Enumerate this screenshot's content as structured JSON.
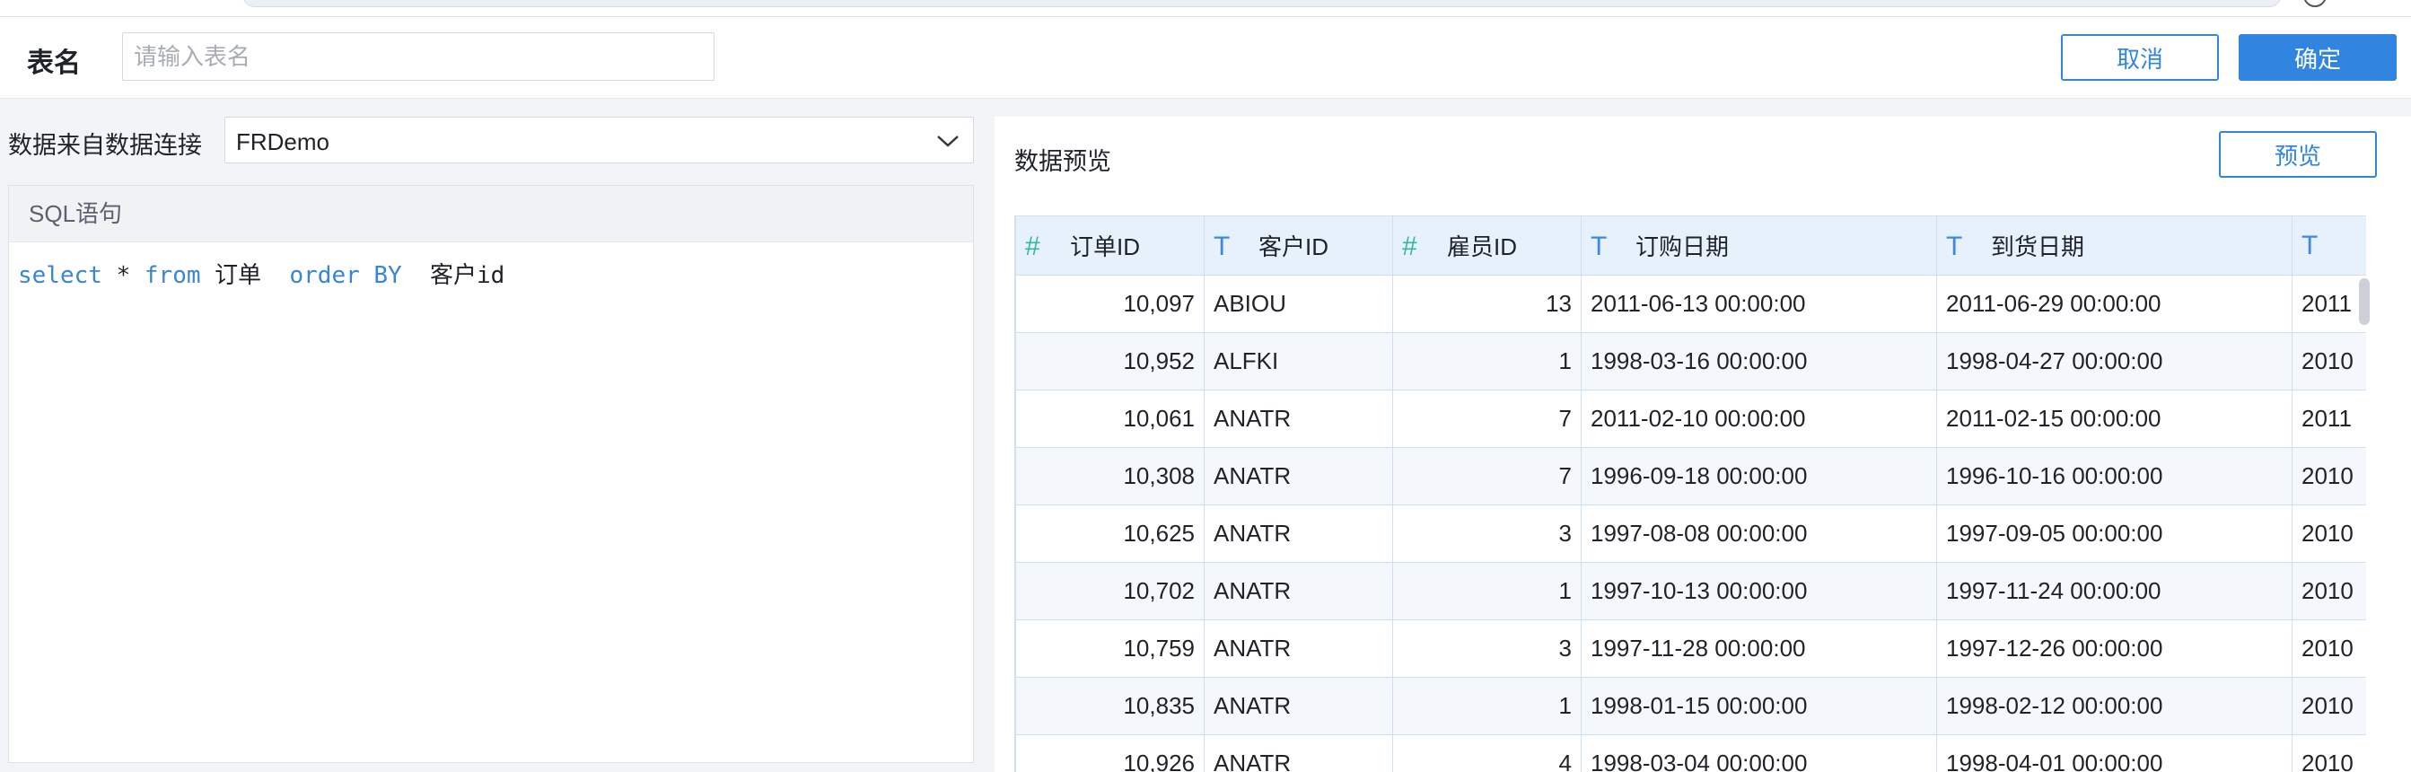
{
  "header": {
    "table_name_label": "表名",
    "table_name_placeholder": "请输入表名",
    "table_name_value": "",
    "cancel_label": "取消",
    "confirm_label": "确定"
  },
  "left": {
    "source_label": "数据来自数据连接",
    "source_value": "FRDemo",
    "sql_title": "SQL语句",
    "sql_tokens": {
      "select": "select",
      "star": " * ",
      "from": "from",
      "table": " 订单  ",
      "order_by": "order BY",
      "column": "  客户id"
    }
  },
  "preview": {
    "title": "数据预览",
    "button_label": "预览",
    "columns": [
      {
        "type": "number",
        "icon": "#",
        "label": "订单ID"
      },
      {
        "type": "text",
        "icon": "T",
        "label": "客户ID"
      },
      {
        "type": "number",
        "icon": "#",
        "label": "雇员ID"
      },
      {
        "type": "text",
        "icon": "T",
        "label": "订购日期"
      },
      {
        "type": "text",
        "icon": "T",
        "label": "到货日期"
      },
      {
        "type": "text",
        "icon": "T",
        "label": ""
      }
    ],
    "rows": [
      [
        "10,097",
        "ABIOU",
        "13",
        "2011-06-13 00:00:00",
        "2011-06-29 00:00:00",
        "2011"
      ],
      [
        "10,952",
        "ALFKI",
        "1",
        "1998-03-16 00:00:00",
        "1998-04-27 00:00:00",
        "2010"
      ],
      [
        "10,061",
        "ANATR",
        "7",
        "2011-02-10 00:00:00",
        "2011-02-15 00:00:00",
        "2011"
      ],
      [
        "10,308",
        "ANATR",
        "7",
        "1996-09-18 00:00:00",
        "1996-10-16 00:00:00",
        "2010"
      ],
      [
        "10,625",
        "ANATR",
        "3",
        "1997-08-08 00:00:00",
        "1997-09-05 00:00:00",
        "2010"
      ],
      [
        "10,702",
        "ANATR",
        "1",
        "1997-10-13 00:00:00",
        "1997-11-24 00:00:00",
        "2010"
      ],
      [
        "10,759",
        "ANATR",
        "3",
        "1997-11-28 00:00:00",
        "1997-12-26 00:00:00",
        "2010"
      ],
      [
        "10,835",
        "ANATR",
        "1",
        "1998-01-15 00:00:00",
        "1998-02-12 00:00:00",
        "2010"
      ],
      [
        "10,926",
        "ANATR",
        "4",
        "1998-03-04 00:00:00",
        "1998-04-01 00:00:00",
        "2010"
      ]
    ]
  }
}
